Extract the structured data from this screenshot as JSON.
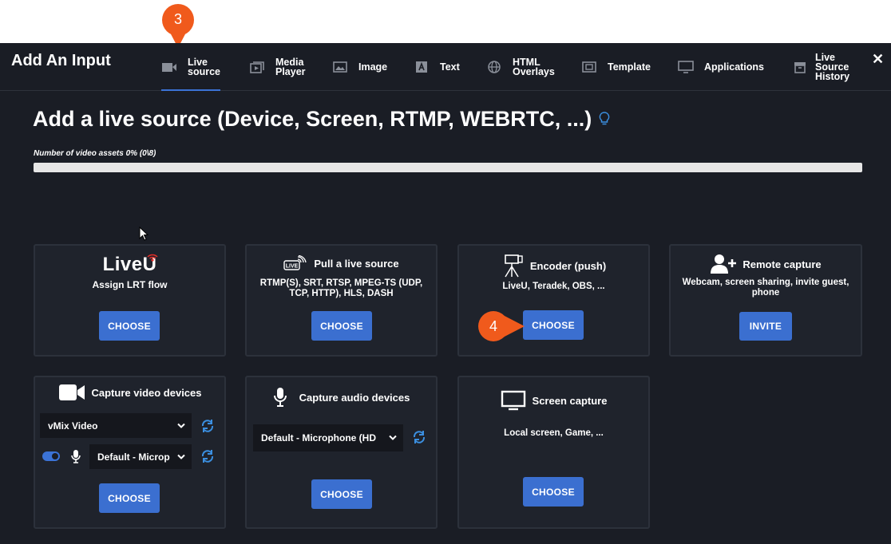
{
  "header": {
    "title": "Add An Input",
    "close": "✕",
    "tabs": [
      {
        "label": "Live\nsource",
        "icon": "camera-icon"
      },
      {
        "label": "Media\nPlayer",
        "icon": "media-player-icon"
      },
      {
        "label": "Image",
        "icon": "image-icon"
      },
      {
        "label": "Text",
        "icon": "text-icon"
      },
      {
        "label": "HTML\nOverlays",
        "icon": "globe-icon"
      },
      {
        "label": "Template",
        "icon": "template-icon"
      },
      {
        "label": "Applications",
        "icon": "monitor-icon"
      },
      {
        "label": "Live\nSource\nHistory",
        "icon": "archive-icon"
      }
    ],
    "active_tab": 0
  },
  "main": {
    "heading": "Add a live source (Device, Screen, RTMP, WEBRTC, ...)",
    "asset_label": "Number of video assets 0% (0\\8)",
    "asset_progress": 0
  },
  "cards": {
    "liveu": {
      "logo": "LiveU",
      "title": "Assign LRT flow",
      "button": "CHOOSE"
    },
    "pull": {
      "title": "Pull a live source",
      "subtitle": "RTMP(S), SRT, RTSP, MPEG-TS (UDP, TCP, HTTP), HLS, DASH",
      "button": "CHOOSE"
    },
    "encoder": {
      "title": "Encoder (push)",
      "subtitle": "LiveU, Teradek, OBS, ...",
      "button": "CHOOSE"
    },
    "remote": {
      "title": "Remote capture",
      "subtitle": "Webcam, screen sharing, invite guest, phone",
      "button": "INVITE"
    },
    "video": {
      "title": "Capture video devices",
      "video_select": "vMix Video",
      "audio_select": "Default - Microp",
      "button": "CHOOSE"
    },
    "audio": {
      "title": "Capture audio devices",
      "select": "Default - Microphone (HD",
      "button": "CHOOSE"
    },
    "screen": {
      "title": "Screen capture",
      "subtitle": "Local screen, Game, ...",
      "button": "CHOOSE"
    }
  },
  "annotations": {
    "step3": "3",
    "step4": "4",
    "color": "#f05a1c"
  },
  "colors": {
    "background": "#1a1d25",
    "card": "#1f232c",
    "accent": "#3b6fd0",
    "liveu_red": "#e52d27"
  }
}
